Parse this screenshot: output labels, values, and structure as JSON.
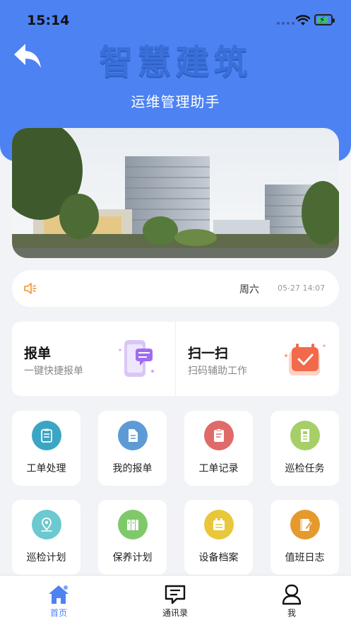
{
  "status_bar": {
    "time": "15:14"
  },
  "header": {
    "title": "智慧建筑",
    "subtitle": "运维管理助手"
  },
  "notice": {
    "weekday": "周六",
    "datetime": "05-27 14:07"
  },
  "quick_actions": [
    {
      "title": "报单",
      "subtitle": "一键快捷报单",
      "icon": "phone-chat-icon"
    },
    {
      "title": "扫一扫",
      "subtitle": "扫码辅助工作",
      "icon": "calendar-check-icon"
    }
  ],
  "grid": [
    {
      "label": "工单处理",
      "color": "#3aa6c4",
      "icon": "clipboard-list-icon"
    },
    {
      "label": "我的报单",
      "color": "#5e9bd6",
      "icon": "document-icon"
    },
    {
      "label": "工单记录",
      "color": "#e06a6a",
      "icon": "clipboard-record-icon"
    },
    {
      "label": "巡检任务",
      "color": "#a6cf68",
      "icon": "file-task-icon"
    },
    {
      "label": "巡检计划",
      "color": "#6bc9cf",
      "icon": "location-pin-icon"
    },
    {
      "label": "保养计划",
      "color": "#7fc96a",
      "icon": "binder-icon"
    },
    {
      "label": "设备档案",
      "color": "#e8c73a",
      "icon": "archive-icon"
    },
    {
      "label": "值班日志",
      "color": "#e59a2e",
      "icon": "notebook-pen-icon"
    }
  ],
  "tabbar": [
    {
      "label": "首页",
      "icon": "home-icon",
      "active": true,
      "color": "#4d82f3"
    },
    {
      "label": "通讯录",
      "icon": "message-icon",
      "active": false
    },
    {
      "label": "我",
      "icon": "user-icon",
      "active": false
    }
  ]
}
